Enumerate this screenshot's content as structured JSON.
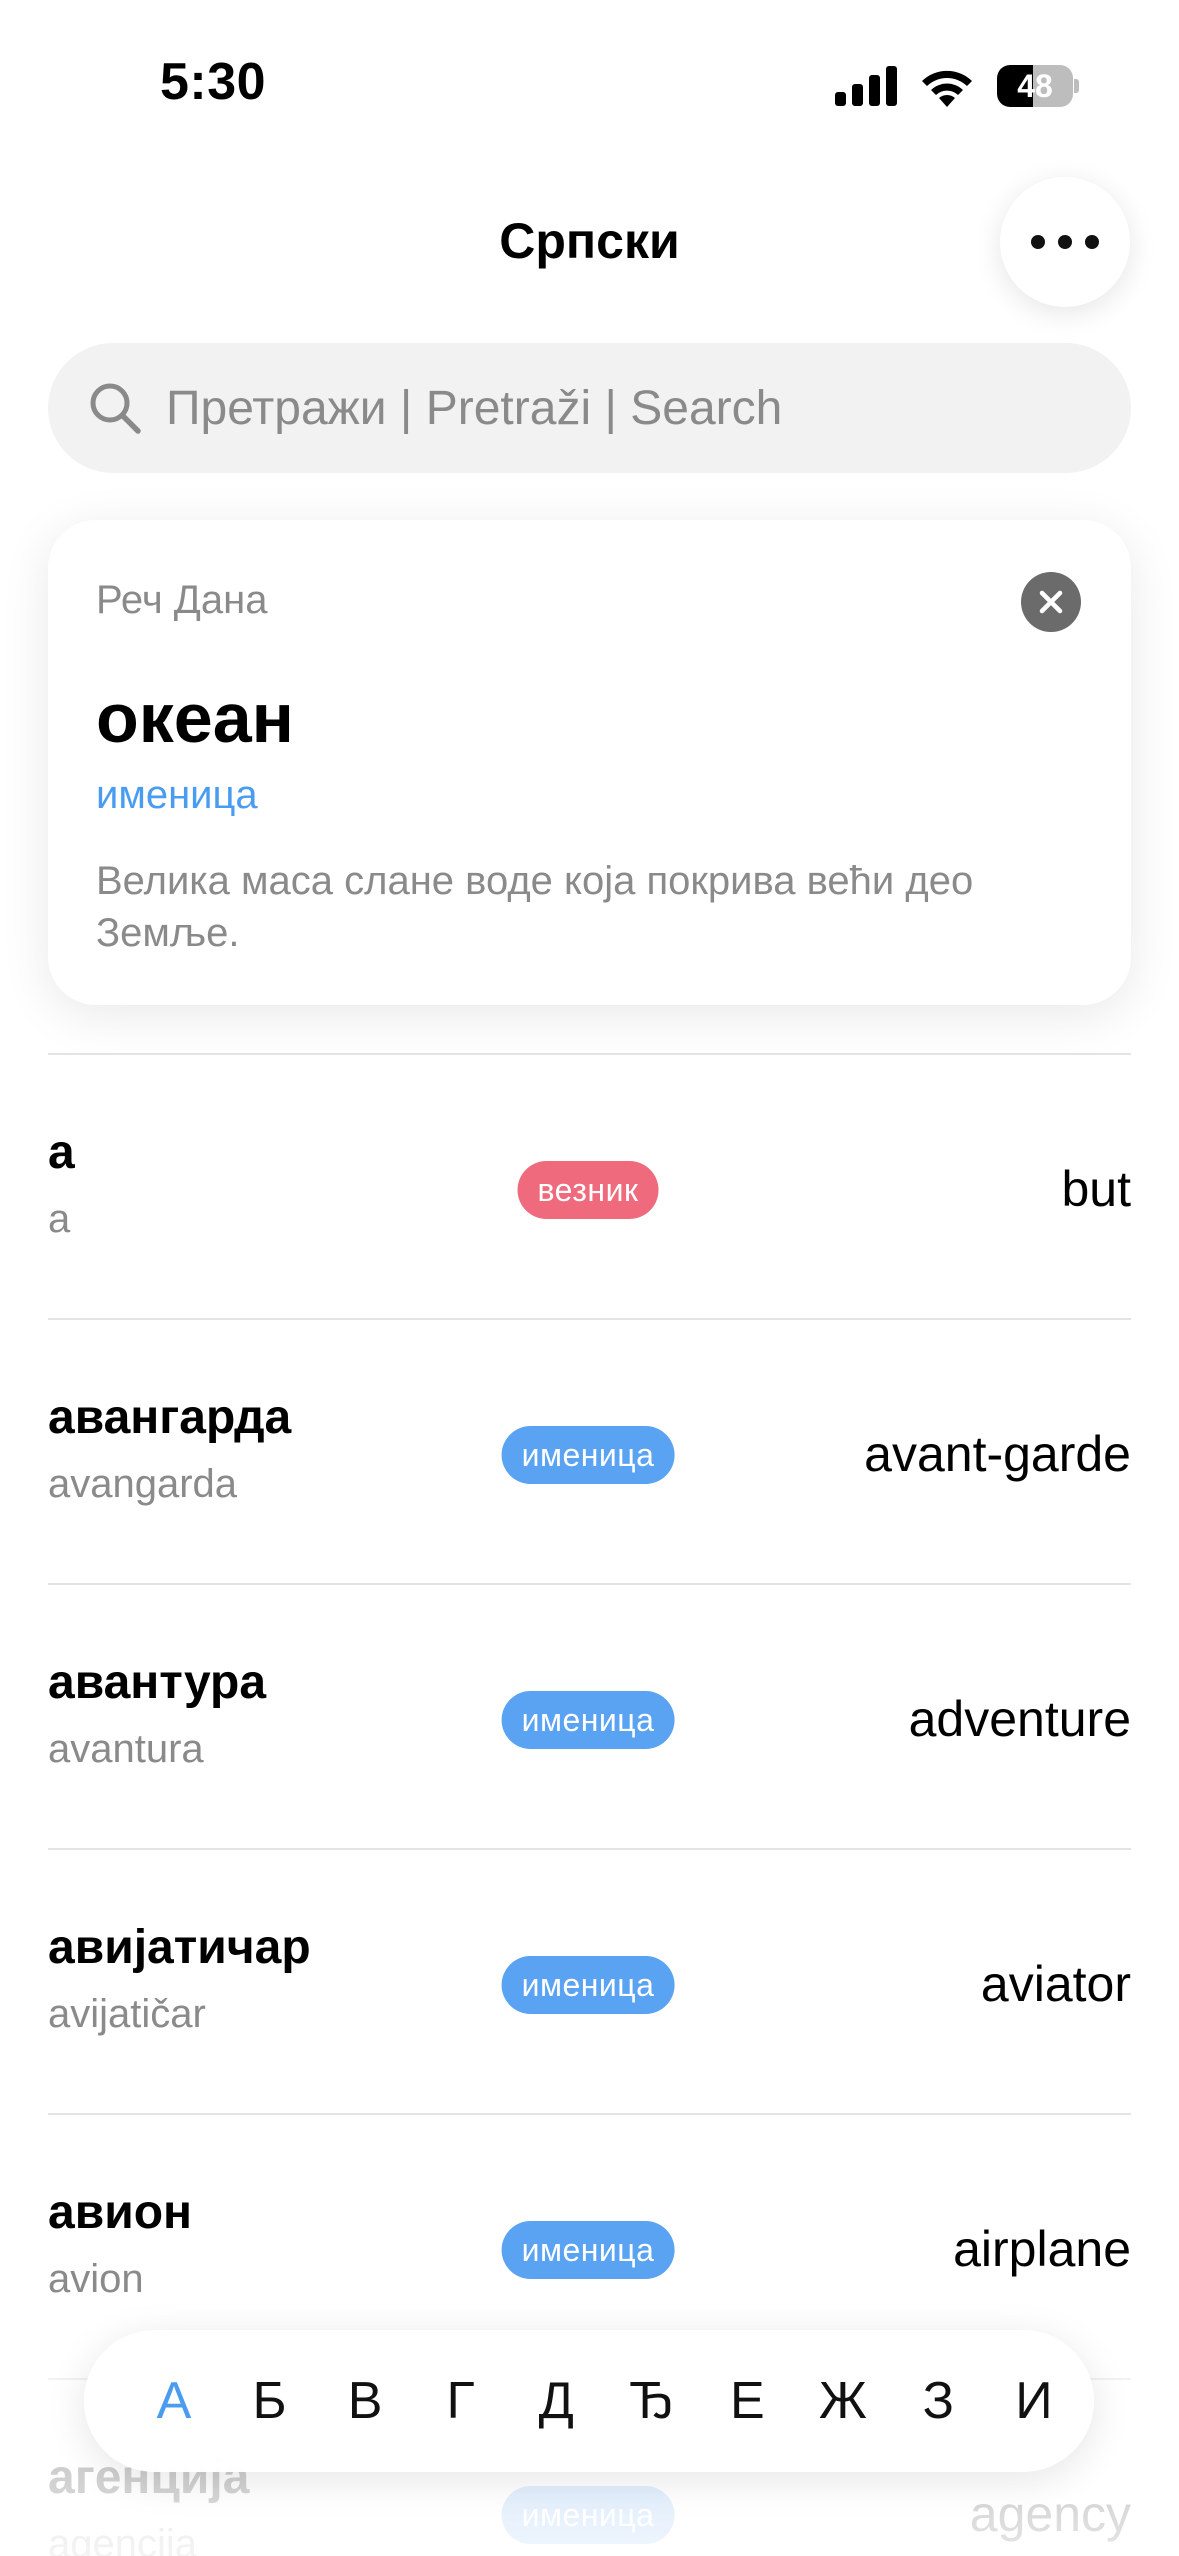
{
  "status_bar": {
    "time": "5:30",
    "battery": "48",
    "battery_level": 0.48
  },
  "nav": {
    "title": "Српски"
  },
  "search": {
    "placeholder": "Претражи | Pretraži | Search"
  },
  "word_of_day": {
    "label": "Реч Дана",
    "word": "океан",
    "part_of_speech": "именица",
    "definition": "Велика маса слане воде која покрива већи део Земље."
  },
  "colors": {
    "accent": "#4a9cf0",
    "noun_badge": "#5aa2f2",
    "conjunction_badge": "#ee6a7c"
  },
  "entries": [
    {
      "word": "а",
      "translit": "a",
      "pos": "везник",
      "pos_type": "conjunction",
      "translation": "but"
    },
    {
      "word": "авангарда",
      "translit": "avangarda",
      "pos": "именица",
      "pos_type": "noun",
      "translation": "avant-garde"
    },
    {
      "word": "авантура",
      "translit": "avantura",
      "pos": "именица",
      "pos_type": "noun",
      "translation": "adventure"
    },
    {
      "word": "авијатичар",
      "translit": "avijatičar",
      "pos": "именица",
      "pos_type": "noun",
      "translation": "aviator"
    },
    {
      "word": "авион",
      "translit": "avion",
      "pos": "именица",
      "pos_type": "noun",
      "translation": "airplane"
    },
    {
      "word": "агенција",
      "translit": "agencija",
      "pos": "именица",
      "pos_type": "noun",
      "translation": "agency"
    }
  ],
  "alphabet": {
    "letters": [
      "А",
      "Б",
      "В",
      "Г",
      "Д",
      "Ђ",
      "Е",
      "Ж",
      "З",
      "И"
    ],
    "active": "А"
  }
}
